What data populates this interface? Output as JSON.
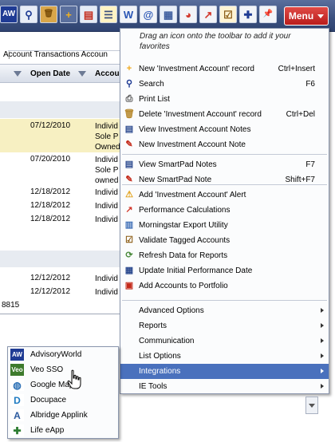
{
  "toolbar": {
    "menu_label": "Menu",
    "icons": [
      {
        "name": "advisoryworld-logo-icon",
        "glyph": "AW",
        "bg": "#1f3b94",
        "fg": "#ffffff"
      },
      {
        "name": "search-icon",
        "glyph": "⚲",
        "bg": "#e8edf6",
        "fg": "#1f3b94"
      },
      {
        "name": "trash-icon",
        "glyph": "🗑",
        "bg": "#d9a64a",
        "fg": "#7a4e0a"
      },
      {
        "name": "add-icon",
        "glyph": "+",
        "bg": "#5a6f9d",
        "fg": "#f3b21d"
      },
      {
        "name": "pdf-icon",
        "glyph": "▤",
        "bg": "#e5ecf6",
        "fg": "#c42a1a"
      },
      {
        "name": "list-icon",
        "glyph": "☰",
        "bg": "#fff3c4",
        "fg": "#3b4f7d"
      },
      {
        "name": "word-doc-icon",
        "glyph": "W",
        "bg": "#f2f4f8",
        "fg": "#2a56b5"
      },
      {
        "name": "email-icon",
        "glyph": "@",
        "bg": "#f2f4f8",
        "fg": "#2a56b5"
      },
      {
        "name": "grid-icon",
        "glyph": "▦",
        "bg": "#eaf0f8",
        "fg": "#3f5f9f"
      },
      {
        "name": "pie-chart-icon",
        "glyph": "◕",
        "bg": "#f2f4f8",
        "fg": "#d2382c"
      },
      {
        "name": "line-chart-icon",
        "glyph": "↗",
        "bg": "#f2f4f8",
        "fg": "#d2382c"
      },
      {
        "name": "checklist-icon",
        "glyph": "☑",
        "bg": "#fff4d4",
        "fg": "#8a5a12"
      },
      {
        "name": "note-pin-icon",
        "glyph": "✚",
        "bg": "#f2f4f8",
        "fg": "#1f3b94"
      },
      {
        "name": "pushpin-icon",
        "glyph": "📌",
        "bg": "#f2f4f8",
        "fg": "#c42a1a"
      }
    ]
  },
  "tabs": [
    "Account Transactions",
    "Accoun"
  ],
  "grid": {
    "columns": [
      "Open Date",
      "Accou"
    ],
    "rows": [
      {
        "date": "07/12/2010",
        "acct": [
          "Individ",
          "Sole P",
          "Owned"
        ],
        "highlight": true
      },
      {
        "date": "07/20/2010",
        "acct": [
          "Individ",
          "Sole P",
          "owned"
        ],
        "highlight": false
      },
      {
        "date": "12/18/2012",
        "acct": [
          "Individ"
        ],
        "highlight": false
      },
      {
        "date": "12/18/2012",
        "acct": [
          "Individ"
        ],
        "highlight": false
      },
      {
        "date": "12/18/2012",
        "acct": [
          "Individ"
        ],
        "highlight": false
      },
      {
        "date": "12/12/2012",
        "acct": [
          "Individ"
        ],
        "highlight": false
      },
      {
        "date": "12/12/2012",
        "acct": [
          "Individ"
        ],
        "highlight": false
      }
    ],
    "total": "8815"
  },
  "menu": {
    "hint": "Drag an icon onto the toolbar to add it your favorites",
    "groups": [
      [
        {
          "label": "New 'Investment Account' record",
          "shortcut": "Ctrl+Insert",
          "icon": "add-record-icon",
          "glyph": "+",
          "color": "#f0a81c"
        },
        {
          "label": "Search",
          "shortcut": "F6",
          "icon": "search-icon",
          "glyph": "⚲",
          "color": "#1f3b94"
        },
        {
          "label": "Print List",
          "shortcut": "",
          "icon": "printer-icon",
          "glyph": "⎙",
          "color": "#555555"
        },
        {
          "label": "Delete 'Investment Account' record",
          "shortcut": "Ctrl+Del",
          "icon": "trash-icon",
          "glyph": "🗑",
          "color": "#b7892e"
        },
        {
          "label": "View Investment Account Notes",
          "shortcut": "",
          "icon": "view-notes-icon",
          "glyph": "▤",
          "color": "#2c4a8f"
        },
        {
          "label": "New Investment Account Note",
          "shortcut": "",
          "icon": "new-note-icon",
          "glyph": "✎",
          "color": "#c42a1a"
        }
      ],
      [
        {
          "label": "View SmartPad Notes",
          "shortcut": "F7",
          "icon": "view-smartpad-icon",
          "glyph": "▤",
          "color": "#2c4a8f"
        },
        {
          "label": "New SmartPad Note",
          "shortcut": "Shift+F7",
          "icon": "new-smartpad-icon",
          "glyph": "✎",
          "color": "#c42a1a"
        }
      ],
      [
        {
          "label": "Add 'Investment Account' Alert",
          "shortcut": "",
          "icon": "alert-icon",
          "glyph": "⚠",
          "color": "#e2a11a"
        },
        {
          "label": "Performance Calculations",
          "shortcut": "",
          "icon": "performance-chart-icon",
          "glyph": "↗",
          "color": "#d2382c"
        },
        {
          "label": "Morningstar Export Utility",
          "shortcut": "",
          "icon": "export-icon",
          "glyph": "▥",
          "color": "#3f6fb7"
        },
        {
          "label": "Validate Tagged Accounts",
          "shortcut": "",
          "icon": "validate-icon",
          "glyph": "☑",
          "color": "#8a5a12"
        },
        {
          "label": "Refresh Data for Reports",
          "shortcut": "",
          "icon": "refresh-icon",
          "glyph": "⟳",
          "color": "#4a8a3c"
        },
        {
          "label": "Update Initial Performance Date",
          "shortcut": "",
          "icon": "calendar-icon",
          "glyph": "▦",
          "color": "#2c4a8f"
        },
        {
          "label": "Add Accounts to Portfolio",
          "shortcut": "",
          "icon": "portfolio-icon",
          "glyph": "▣",
          "color": "#c42a1a"
        }
      ],
      [
        {
          "label": "Advanced Options",
          "submenu": true
        },
        {
          "label": "Reports",
          "submenu": true
        },
        {
          "label": "Communication",
          "submenu": true
        },
        {
          "label": "List Options",
          "submenu": true
        },
        {
          "label": "Integrations",
          "submenu": true,
          "highlight": true
        },
        {
          "label": "IE Tools",
          "submenu": true
        }
      ]
    ]
  },
  "submenu": [
    {
      "label": "AdvisoryWorld",
      "icon": "advisoryworld-icon",
      "glyph": "AW",
      "bg": "#1f3b94",
      "fg": "#ffffff"
    },
    {
      "label": "Veo SSO",
      "icon": "veo-icon",
      "glyph": "Veo",
      "bg": "#3d7a2c",
      "fg": "#ffffff"
    },
    {
      "label": "Google Maps",
      "icon": "globe-icon",
      "glyph": "◍",
      "bg": "#ffffff",
      "fg": "#2a6fb5"
    },
    {
      "label": "Docupace",
      "icon": "docupace-icon",
      "glyph": "D",
      "bg": "#ffffff",
      "fg": "#1d7ac2"
    },
    {
      "label": "Albridge Applink",
      "icon": "albridge-icon",
      "glyph": "A",
      "bg": "#ffffff",
      "fg": "#2b5a9e"
    },
    {
      "label": "Life eApp",
      "icon": "life-eapp-icon",
      "glyph": "✚",
      "bg": "#ffffff",
      "fg": "#2e7d32"
    }
  ]
}
